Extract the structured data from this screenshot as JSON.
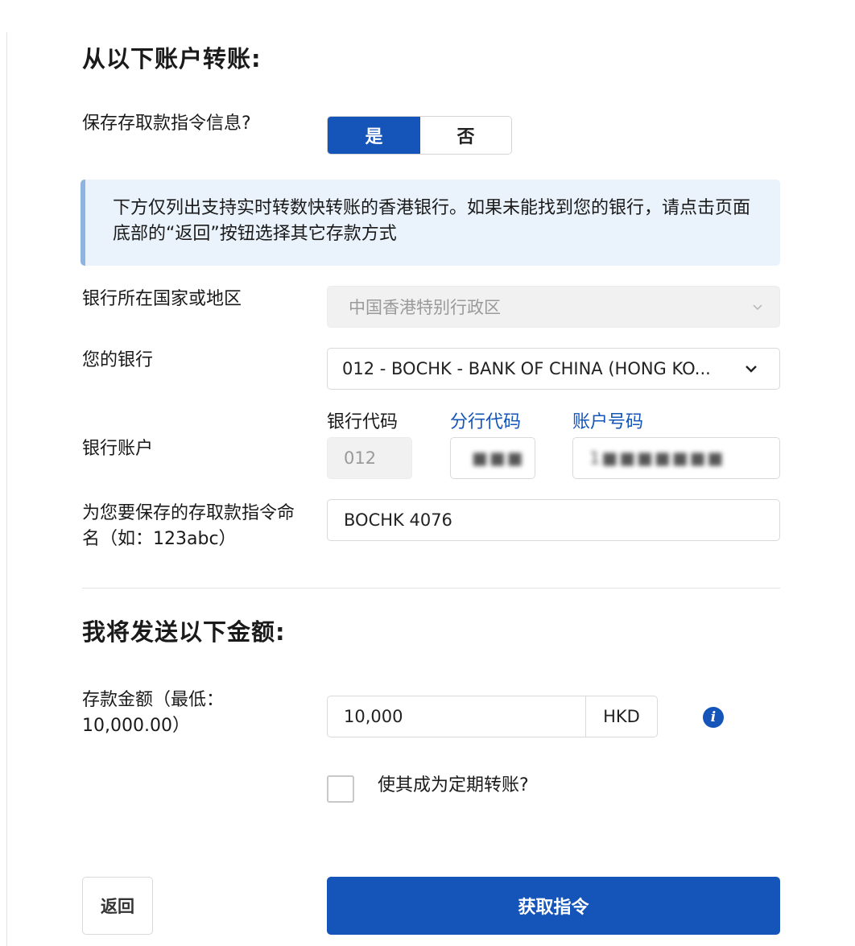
{
  "sections": {
    "transfer_from_title": "从以下账户转账:",
    "amount_title": "我将发送以下金额:"
  },
  "save_instruction": {
    "label": "保存存取款指令信息?",
    "yes": "是",
    "no": "否",
    "selected": "是"
  },
  "notice": {
    "text": "下方仅列出支持实时转数快转账的香港银行。如果未能找到您的银行，请点击页面底部的“返回”按钮选择其它存款方式"
  },
  "bank_country": {
    "label": "银行所在国家或地区",
    "value": "中国香港特别行政区",
    "chevron_icon": "chevron-down-icon"
  },
  "bank": {
    "label": "您的银行",
    "value": "012 - BOCHK - BANK OF CHINA (HONG KO...",
    "chevron_icon": "chevron-down-icon"
  },
  "bank_account": {
    "label": "银行账户",
    "bank_code_label": "银行代码",
    "branch_code_label": "分行代码",
    "account_number_label": "账户号码",
    "bank_code_value": "012",
    "branch_code_value": "■■■",
    "account_number_value": "1■■■■■■■"
  },
  "instruction_name": {
    "label": "为您要保存的存取款指令命名（如：123abc）",
    "value": "BOCHK 4076"
  },
  "amount": {
    "label": "存款金额（最低：10,000.00）",
    "value": "10,000",
    "currency": "HKD",
    "info_icon": "info-icon"
  },
  "recurring": {
    "label": "使其成为定期转账?",
    "checked": false
  },
  "actions": {
    "back": "返回",
    "get_instruction": "获取指令"
  },
  "colors": {
    "primary": "#1554b8",
    "notice_bg": "#eaf2fb",
    "notice_border": "#8fb4e0"
  }
}
